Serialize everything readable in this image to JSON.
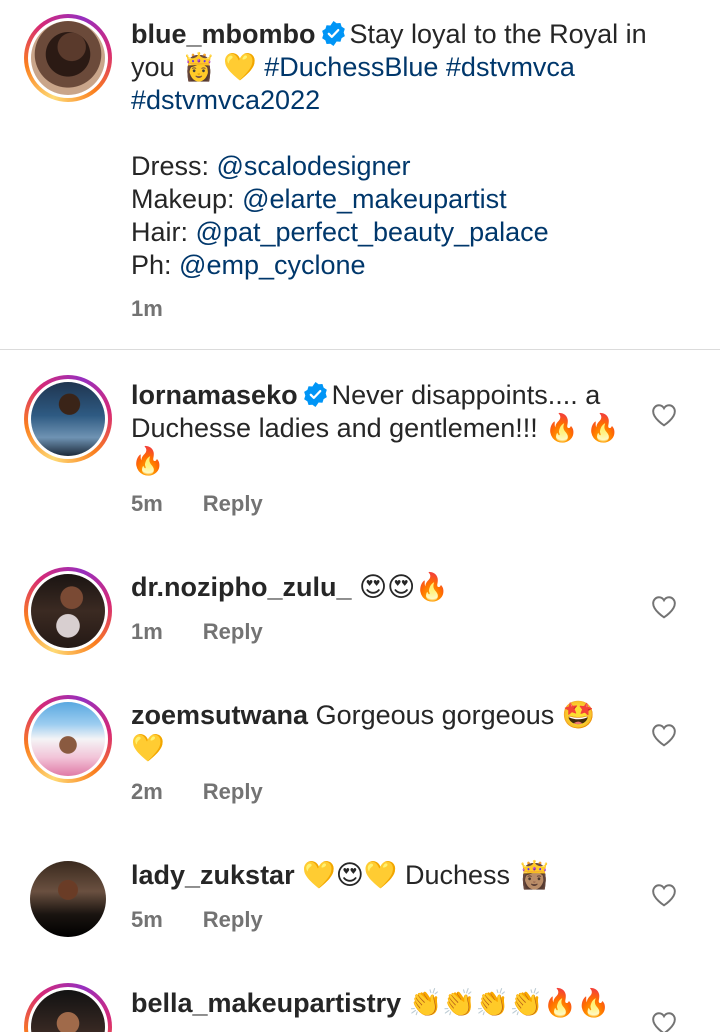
{
  "caption": {
    "username": "blue_mbombo",
    "verified": true,
    "text_1": "Stay loyal to the Royal in you 👸 💛 ",
    "hashtags": [
      "#DuchessBlue",
      "#dstvmvca",
      "#dstvmvca2022"
    ],
    "credits": [
      {
        "label": "Dress: ",
        "mention": "@scalodesigner"
      },
      {
        "label": "Makeup: ",
        "mention": "@elarte_makeupartist"
      },
      {
        "label": "Hair: ",
        "mention": "@pat_perfect_beauty_palace"
      },
      {
        "label": "Ph: ",
        "mention": "@emp_cyclone"
      }
    ],
    "time": "1m"
  },
  "comments": [
    {
      "username": "lornamaseko",
      "verified": true,
      "text": "Never disappoints.... a Duchesse ladies and gentlemen!!! 🔥 🔥 🔥",
      "time": "5m",
      "reply": "Reply"
    },
    {
      "username": "dr.nozipho_zulu_",
      "verified": false,
      "text": "😍😍🔥",
      "time": "1m",
      "reply": "Reply"
    },
    {
      "username": "zoemsutwana",
      "verified": false,
      "text": "Gorgeous gorgeous 🤩 💛",
      "time": "2m",
      "reply": "Reply"
    },
    {
      "username": "lady_zukstar",
      "verified": false,
      "text": "💛😍💛 Duchess 👸🏽",
      "time": "5m",
      "reply": "Reply"
    },
    {
      "username": "bella_makeupartistry",
      "verified": false,
      "text": "👏👏👏👏🔥🔥",
      "time": "",
      "reply": ""
    }
  ],
  "icons": {
    "verified": "verified-badge-icon",
    "like": "heart-outline-icon"
  },
  "colors": {
    "mention": "#00376b",
    "secondary_text": "#737373",
    "verified_blue": "#0095f6",
    "divider": "#dbdbdb"
  }
}
